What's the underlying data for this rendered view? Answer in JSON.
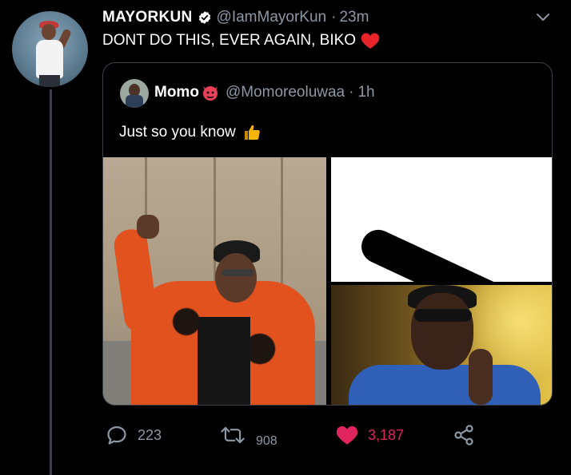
{
  "tweet": {
    "author_name": "MAYORKUN",
    "author_handle": "@IamMayorKun",
    "time": "23m",
    "text": "DONT DO THIS, EVER AGAIN, BIKO",
    "verified_icon": "verified-badge-icon",
    "emoji": "red-heart-emoji"
  },
  "quote": {
    "author_name": "Momo",
    "emoji": "devil-emoji",
    "author_handle": "@Momoreoluwaa",
    "time": "1h",
    "text": "Just so you know",
    "text_emoji": "thumbs-up-emoji"
  },
  "actions": {
    "reply_count": "223",
    "retweet_count": "908",
    "like_count": "3,187"
  },
  "colors": {
    "background": "#000000",
    "secondary_text": "#8b98a5",
    "like_accent": "#e0245e",
    "verified_blue": "#ffffff",
    "border": "#3d4147"
  }
}
